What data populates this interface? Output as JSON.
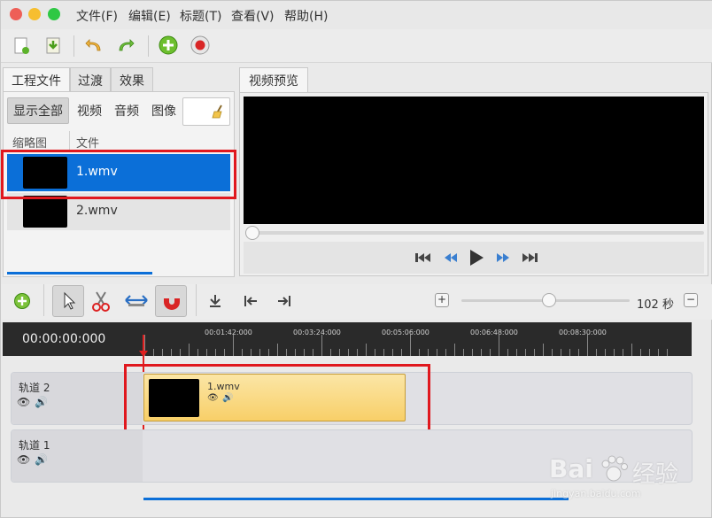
{
  "menu": [
    "文件(F)",
    "编辑(E)",
    "标题(T)",
    "查看(V)",
    "帮助(H)"
  ],
  "left_tabs": [
    "工程文件",
    "过渡",
    "效果"
  ],
  "filters": [
    "显示全部",
    "视频",
    "音频",
    "图像"
  ],
  "columns": {
    "thumb": "缩略图",
    "file": "文件"
  },
  "files": [
    {
      "name": "1.wmv",
      "selected": true
    },
    {
      "name": "2.wmv",
      "selected": false
    }
  ],
  "preview_tab": "视频预览",
  "zoom_label": "102 秒",
  "timecode": "00:00:00:000",
  "ruler_ticks": [
    "00:01:42:000",
    "00:03:24:000",
    "00:05:06:000",
    "00:06:48:000",
    "00:08:30:000"
  ],
  "tracks": [
    {
      "name": "轨道 2",
      "clip": "1.wmv"
    },
    {
      "name": "轨道 1",
      "clip": ""
    }
  ],
  "watermark": {
    "text1": "Bai",
    "text2": "经验",
    "url": "jingyan.baidu.com"
  },
  "colors": {
    "accent": "#0b6fd8",
    "highlight": "#e0181e",
    "clip": "#fbd978"
  }
}
